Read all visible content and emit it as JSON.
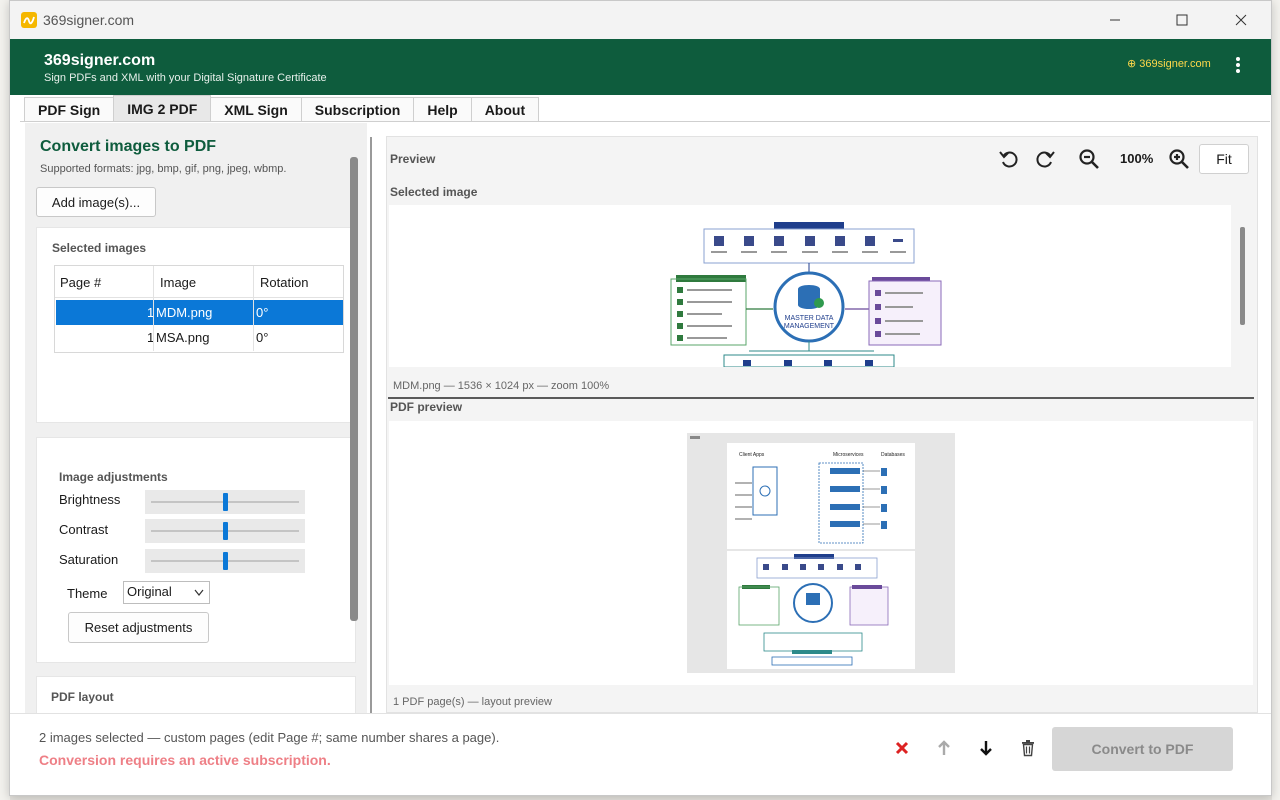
{
  "window": {
    "title": "369signer.com"
  },
  "header": {
    "title": "369signer.com",
    "subtitle": "Sign PDFs and XML with your Digital Signature Certificate",
    "link": "369signer.com"
  },
  "tabs": [
    {
      "label": "PDF Sign"
    },
    {
      "label": "IMG 2 PDF",
      "active": true
    },
    {
      "label": "XML Sign"
    },
    {
      "label": "Subscription"
    },
    {
      "label": "Help"
    },
    {
      "label": "About"
    }
  ],
  "left": {
    "heading": "Convert images to PDF",
    "formats": "Supported formats: jpg, bmp, gif, png, jpeg, wbmp.",
    "add_button": "Add image(s)...",
    "selected_label": "Selected images",
    "columns": [
      "Page #",
      "Image",
      "Rotation"
    ],
    "rows": [
      {
        "page": "1",
        "image": "MDM.png",
        "rotation": "0°",
        "selected": true
      },
      {
        "page": "1",
        "image": "MSA.png",
        "rotation": "0°",
        "selected": false
      }
    ],
    "adjustments": {
      "label": "Image adjustments",
      "brightness": {
        "label": "Brightness",
        "value": 0.5
      },
      "contrast": {
        "label": "Contrast",
        "value": 0.5
      },
      "saturation": {
        "label": "Saturation",
        "value": 0.5
      },
      "theme_label": "Theme",
      "theme_value": "Original",
      "reset_button": "Reset adjustments"
    },
    "pdf_layout_label": "PDF layout"
  },
  "preview": {
    "label": "Preview",
    "zoom": "100%",
    "fit_button": "Fit",
    "selected_image_label": "Selected image",
    "image_caption": "MDM.png — 1536 × 1024 px — zoom 100%",
    "pdf_preview_label": "PDF preview",
    "pdf_caption": "1 PDF page(s) — layout preview",
    "mdm_center_text": "MASTER DATA MANAGEMENT",
    "msa_headers": [
      "Client Apps",
      "Microservices",
      "Databases"
    ]
  },
  "footer": {
    "status": "2 images selected — custom pages (edit Page #; same number shares a page).",
    "warning": "Conversion requires an active subscription.",
    "convert_button": "Convert to PDF"
  },
  "colors": {
    "brand": "#0e5c3d",
    "accent": "#0b78d7",
    "warning": "#ee7f86",
    "link": "#ffd84a"
  }
}
